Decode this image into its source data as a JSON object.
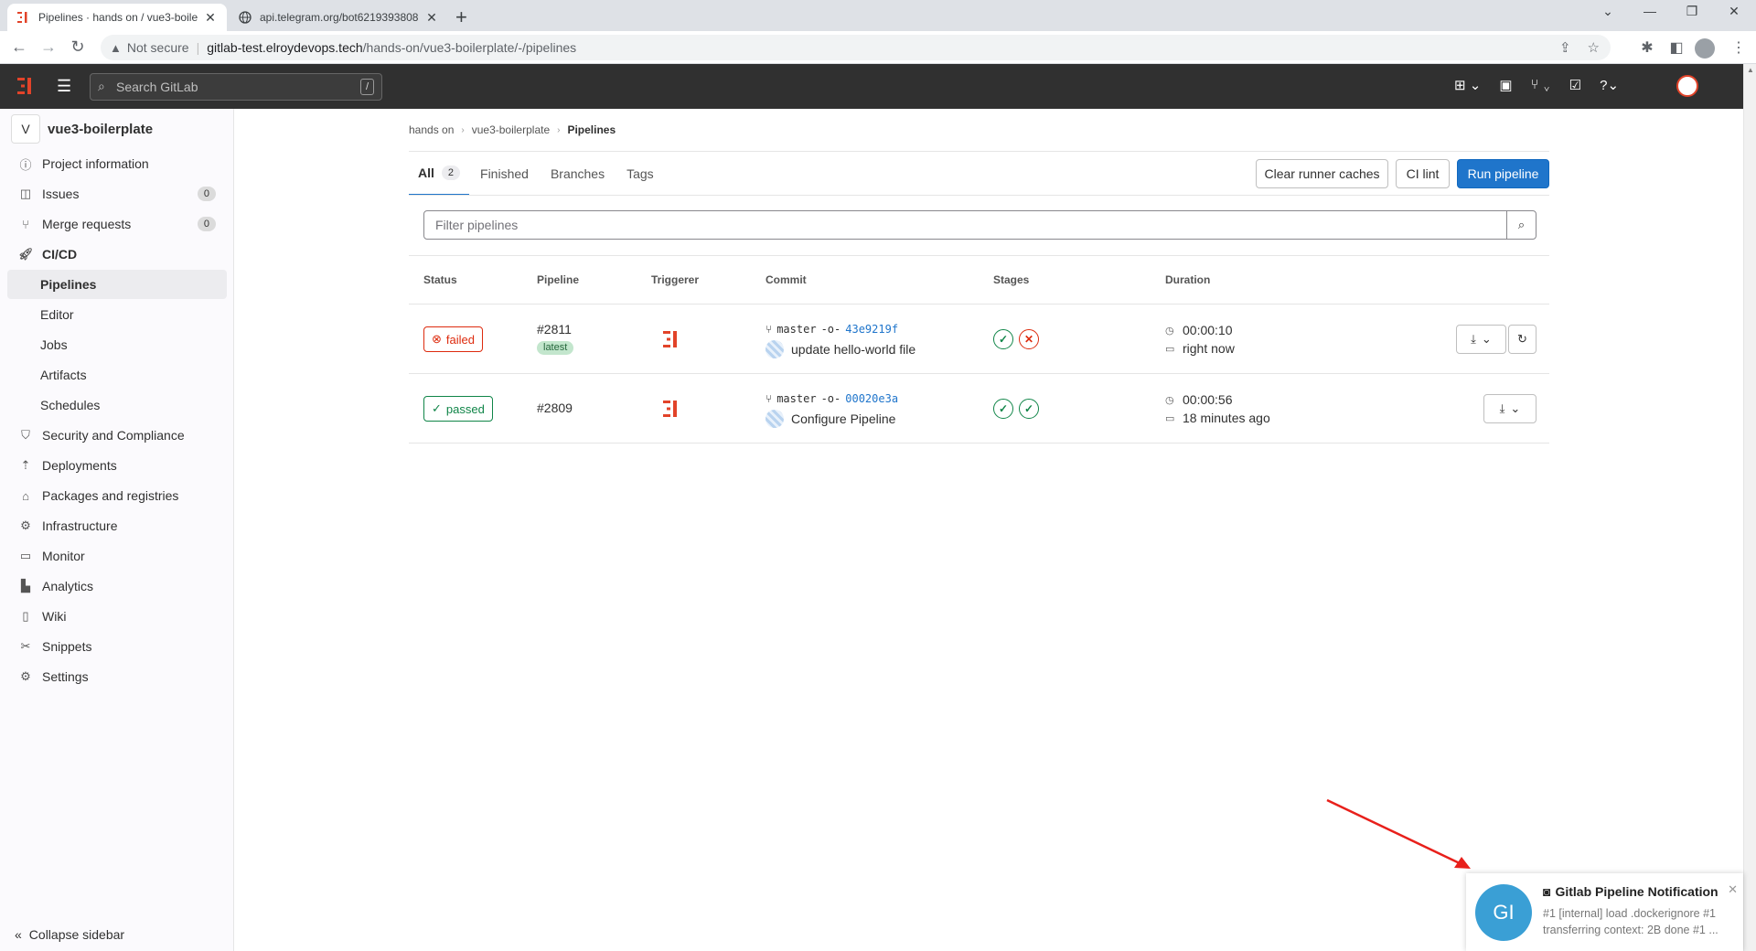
{
  "browser": {
    "tabs": [
      {
        "title": "Pipelines · hands on / vue3-boile",
        "active": true
      },
      {
        "title": "api.telegram.org/bot6219393808",
        "active": false
      }
    ],
    "url_warning": "Not secure",
    "url_host": "gitlab-test.elroydevops.tech",
    "url_path": "/hands-on/vue3-boilerplate/-/pipelines"
  },
  "topnav": {
    "search_placeholder": "Search GitLab",
    "search_shortcut": "/"
  },
  "sidebar": {
    "project_initial": "V",
    "project_name": "vue3-boilerplate",
    "items": [
      {
        "label": "Project information",
        "icon": "info-icon"
      },
      {
        "label": "Issues",
        "icon": "issues-icon",
        "count": "0"
      },
      {
        "label": "Merge requests",
        "icon": "merge-request-icon",
        "count": "0"
      },
      {
        "label": "CI/CD",
        "icon": "rocket-icon"
      },
      {
        "label": "Pipelines"
      },
      {
        "label": "Editor"
      },
      {
        "label": "Jobs"
      },
      {
        "label": "Artifacts"
      },
      {
        "label": "Schedules"
      },
      {
        "label": "Security and Compliance",
        "icon": "shield-icon"
      },
      {
        "label": "Deployments",
        "icon": "deployments-icon"
      },
      {
        "label": "Packages and registries",
        "icon": "package-icon"
      },
      {
        "label": "Infrastructure",
        "icon": "cloud-gear-icon"
      },
      {
        "label": "Monitor",
        "icon": "monitor-icon"
      },
      {
        "label": "Analytics",
        "icon": "chart-icon"
      },
      {
        "label": "Wiki",
        "icon": "book-icon"
      },
      {
        "label": "Snippets",
        "icon": "scissors-icon"
      },
      {
        "label": "Settings",
        "icon": "gear-icon"
      }
    ],
    "collapse_label": "Collapse sidebar"
  },
  "breadcrumb": [
    "hands on",
    "vue3-boilerplate",
    "Pipelines"
  ],
  "tabs": [
    {
      "label": "All",
      "count": "2"
    },
    {
      "label": "Finished"
    },
    {
      "label": "Branches"
    },
    {
      "label": "Tags"
    }
  ],
  "buttons": {
    "clear_caches": "Clear runner caches",
    "ci_lint": "CI lint",
    "run_pipeline": "Run pipeline"
  },
  "filter_placeholder": "Filter pipelines",
  "table": {
    "headers": [
      "Status",
      "Pipeline",
      "Triggerer",
      "Commit",
      "Stages",
      "Duration"
    ],
    "rows": [
      {
        "status": "failed",
        "pipeline": "#2811",
        "tag": "latest",
        "branch": "master",
        "sha": "43e9219f",
        "message": "update hello-world file",
        "stages": [
          "passed",
          "failed"
        ],
        "duration": "00:00:10",
        "finished": "right now"
      },
      {
        "status": "passed",
        "pipeline": "#2809",
        "branch": "master",
        "sha": "00020e3a",
        "message": "Configure Pipeline",
        "stages": [
          "passed",
          "passed"
        ],
        "duration": "00:00:56",
        "finished": "18 minutes ago"
      }
    ]
  },
  "notification": {
    "avatar": "GI",
    "title": "Gitlab Pipeline Notification",
    "body": "#1 [internal] load .dockerignore #1 transferring context: 2B done #1 ..."
  },
  "colors": {
    "accent": "#1f75cb",
    "failed": "#dd2b0e",
    "passed": "#108548",
    "topnav": "#303030"
  }
}
